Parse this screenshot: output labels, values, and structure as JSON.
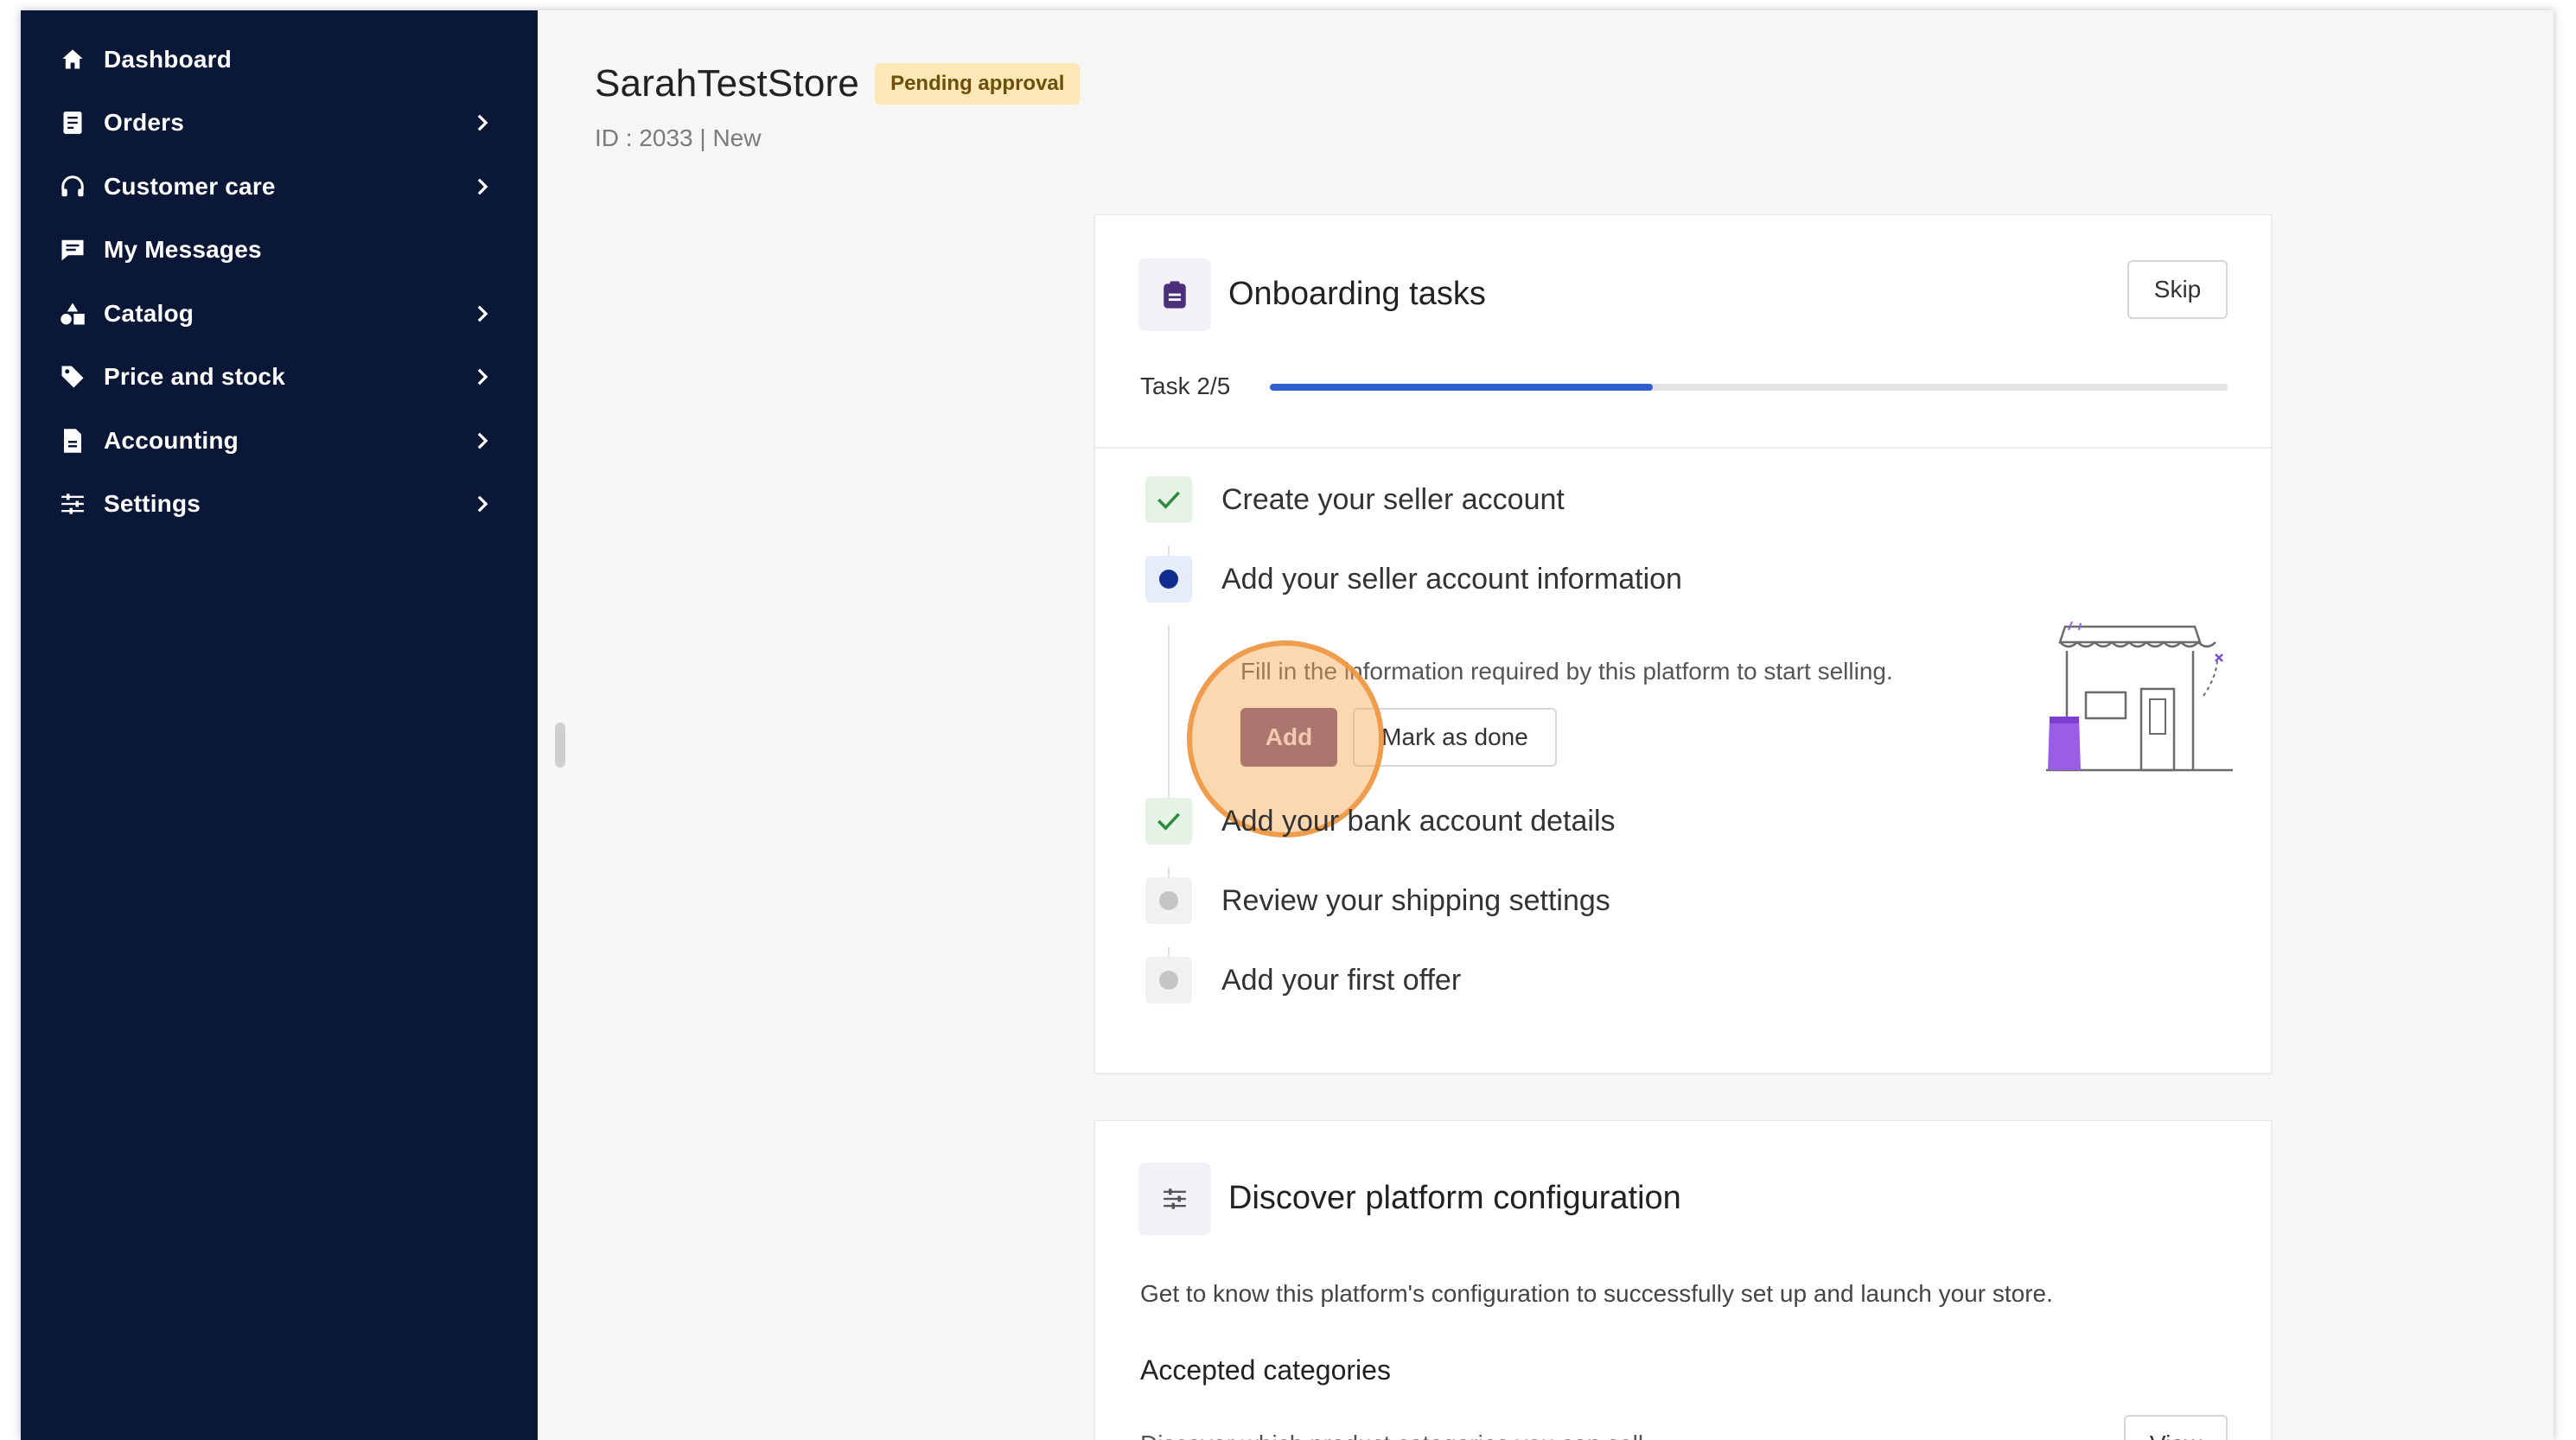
{
  "sidebar": {
    "items": [
      {
        "label": "Dashboard",
        "icon": "home-icon",
        "has_submenu": false
      },
      {
        "label": "Orders",
        "icon": "orders-icon",
        "has_submenu": true
      },
      {
        "label": "Customer care",
        "icon": "headset-icon",
        "has_submenu": true
      },
      {
        "label": "My Messages",
        "icon": "message-icon",
        "has_submenu": false
      },
      {
        "label": "Catalog",
        "icon": "shapes-icon",
        "has_submenu": true
      },
      {
        "label": "Price and stock",
        "icon": "tag-icon",
        "has_submenu": true
      },
      {
        "label": "Accounting",
        "icon": "document-icon",
        "has_submenu": true
      },
      {
        "label": "Settings",
        "icon": "sliders-icon",
        "has_submenu": true
      }
    ]
  },
  "store": {
    "name": "SarahTestStore",
    "status_badge": "Pending approval",
    "meta": "ID : 2033 | New"
  },
  "onboarding": {
    "title": "Onboarding tasks",
    "skip_label": "Skip",
    "task_count": "Task 2/5",
    "progress": 0.4,
    "tasks": [
      {
        "label": "Create your seller account",
        "status": "done"
      },
      {
        "label": "Add your seller account information",
        "status": "active",
        "description": "Fill in the information required by this platform to start selling.",
        "add_label": "Add",
        "mark_done_label": "Mark as done"
      },
      {
        "label": "Add your bank account details",
        "status": "done"
      },
      {
        "label": "Review your shipping settings",
        "status": "todo"
      },
      {
        "label": "Add your first offer",
        "status": "todo"
      }
    ]
  },
  "discover": {
    "title": "Discover platform configuration",
    "description": "Get to know this platform's configuration to successfully set up and launch your store.",
    "section_heading": "Accepted categories",
    "section_description": "Discover which product categories you can sell",
    "view_label": "View"
  },
  "colors": {
    "sidebar_bg": "#0b1736",
    "accent_blue": "#2f5fd3",
    "add_button": "#6a4e85",
    "badge_bg": "#fbe8b6",
    "done_green": "#2e8b3d",
    "click_highlight": "#f8a852"
  }
}
